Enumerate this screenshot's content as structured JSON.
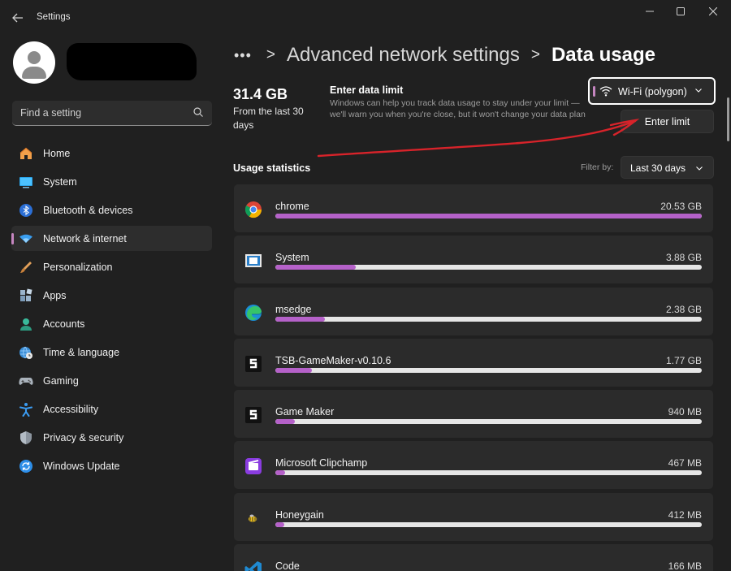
{
  "window": {
    "title": "Settings",
    "controls": [
      "minimize",
      "maximize",
      "close"
    ]
  },
  "sidebar": {
    "search_placeholder": "Find a setting",
    "items": [
      {
        "label": "Home",
        "icon": "home-icon"
      },
      {
        "label": "System",
        "icon": "system-icon"
      },
      {
        "label": "Bluetooth & devices",
        "icon": "bluetooth-icon"
      },
      {
        "label": "Network & internet",
        "icon": "network-icon",
        "active": true
      },
      {
        "label": "Personalization",
        "icon": "brush-icon"
      },
      {
        "label": "Apps",
        "icon": "apps-icon"
      },
      {
        "label": "Accounts",
        "icon": "accounts-icon"
      },
      {
        "label": "Time & language",
        "icon": "globe-clock-icon"
      },
      {
        "label": "Gaming",
        "icon": "gamepad-icon"
      },
      {
        "label": "Accessibility",
        "icon": "accessibility-icon"
      },
      {
        "label": "Privacy & security",
        "icon": "shield-icon"
      },
      {
        "label": "Windows Update",
        "icon": "update-icon"
      }
    ]
  },
  "breadcrumb": {
    "dots": "•••",
    "separator": ">",
    "parent": "Advanced network settings",
    "current": "Data usage"
  },
  "summary": {
    "total": "31.4 GB",
    "period": "From the last 30 days"
  },
  "data_limit": {
    "title": "Enter data limit",
    "description": "Windows can help you track data usage to stay under your limit —we'll warn you when you're close, but it won't change your data plan",
    "button": "Enter limit"
  },
  "network_select": {
    "value": "Wi-Fi (polygon)"
  },
  "stats": {
    "title": "Usage statistics",
    "filter_label": "Filter by:",
    "filter_value": "Last 30 days"
  },
  "apps": [
    {
      "name": "chrome",
      "usage": "20.53 GB",
      "fraction": 1.0,
      "icon": "chrome-icon"
    },
    {
      "name": "System",
      "usage": "3.88 GB",
      "fraction": 0.189,
      "icon": "system-app-icon"
    },
    {
      "name": "msedge",
      "usage": "2.38 GB",
      "fraction": 0.116,
      "icon": "edge-icon"
    },
    {
      "name": "TSB-GameMaker-v0.10.6",
      "usage": "1.77 GB",
      "fraction": 0.086,
      "icon": "gamemaker-icon"
    },
    {
      "name": "Game Maker",
      "usage": "940 MB",
      "fraction": 0.045,
      "icon": "gamemaker-icon"
    },
    {
      "name": "Microsoft Clipchamp",
      "usage": "467 MB",
      "fraction": 0.022,
      "icon": "clipchamp-icon"
    },
    {
      "name": "Honeygain",
      "usage": "412 MB",
      "fraction": 0.02,
      "icon": "honeygain-icon"
    },
    {
      "name": "Code",
      "usage": "166 MB",
      "fraction": 0.008,
      "icon": "vscode-icon"
    }
  ],
  "colors": {
    "accent": "#c586c0",
    "bar_fill": "#b561c9",
    "bar_track": "#e6e6e6",
    "background": "#202020",
    "card": "#2b2b2b",
    "annotation": "#d8232a"
  }
}
